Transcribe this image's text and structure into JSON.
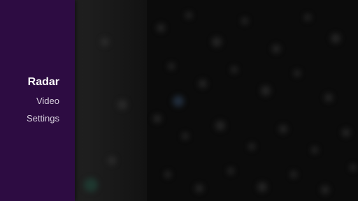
{
  "navigation": {
    "items": [
      {
        "label": "Radar",
        "selected": true
      },
      {
        "label": "Video",
        "selected": false
      },
      {
        "label": "Settings",
        "selected": false
      }
    ]
  },
  "colors": {
    "nav_background": "#2d0c42",
    "content_background": "#0b0b0b",
    "selected_text": "#ffffff",
    "text": "#d8d0de"
  }
}
